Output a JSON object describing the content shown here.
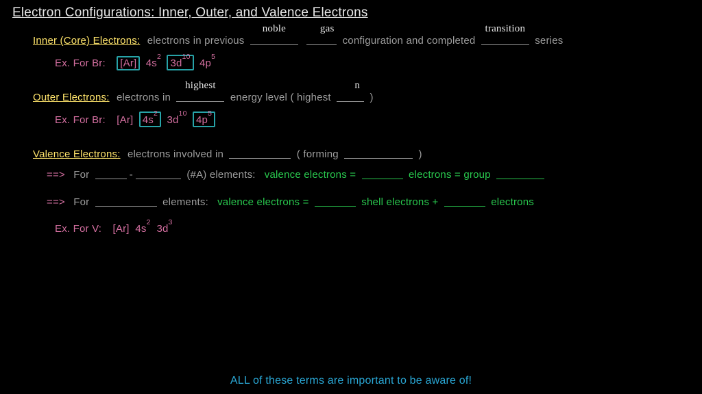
{
  "title": "Electron Configurations: Inner, Outer, and Valence Electrons",
  "inner": {
    "header": "Inner (Core) Electrons:",
    "pre": "electrons in previous",
    "fill1a": "noble",
    "fill1b": "gas",
    "mid": "configuration and completed",
    "fill2": "transition",
    "post": "series",
    "ex_label": "Ex. For  Br:",
    "cfg": {
      "ar": "[Ar]",
      "s": "4s",
      "s_sup": "2",
      "d": "3d",
      "d_sup": "10",
      "p": "4p",
      "p_sup": "5"
    }
  },
  "outer": {
    "header": "Outer Electrons:",
    "pre": "electrons in",
    "fill1": "highest",
    "mid": "energy level ( highest",
    "fill2": "n",
    "post": ")",
    "ex_label": "Ex. For  Br:",
    "cfg": {
      "ar": "[Ar]",
      "s": "4s",
      "s_sup": "2",
      "d": "3d",
      "d_sup": "10",
      "p": "4p",
      "p_sup": "5"
    }
  },
  "valence": {
    "header": "Valence Electrons:",
    "pre": "electrons involved in",
    "mid": "( forming",
    "post": ")",
    "rule1": {
      "arrow": "==>",
      "pre": "For",
      "dash": "-",
      "tag": "(#A) elements:",
      "eq": "valence electrons   =",
      "mid": "electrons   =   group"
    },
    "rule2": {
      "arrow": "==>",
      "pre": "For",
      "tag": "elements:",
      "eq": "valence electrons   =",
      "mid": "shell electrons   +",
      "post": "electrons"
    },
    "ex_label": "Ex. For  V:",
    "cfg": {
      "ar": "[Ar]",
      "s": "4s",
      "s_sup": "2",
      "d": "3d",
      "d_sup": "3"
    }
  },
  "footer": "ALL of these terms are important to be aware of!"
}
